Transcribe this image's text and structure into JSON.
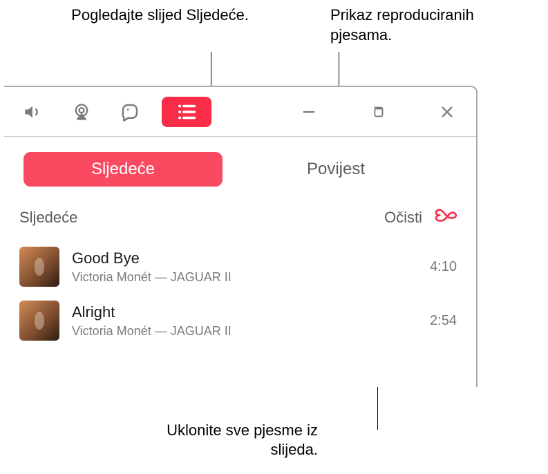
{
  "annotations": {
    "queue": "Pogledajte slijed Sljedeće.",
    "history": "Prikaz reproduciranih pjesama.",
    "clear": "Uklonite sve pjesme iz slijeda."
  },
  "tabs": {
    "next": "Sljedeće",
    "history": "Povijest"
  },
  "section": {
    "title": "Sljedeće",
    "clear": "Očisti"
  },
  "tracks": [
    {
      "title": "Good Bye",
      "artist": "Victoria Monét",
      "album": "JAGUAR II",
      "duration": "4:10"
    },
    {
      "title": "Alright",
      "artist": "Victoria Monét",
      "album": "JAGUAR II",
      "duration": "2:54"
    }
  ]
}
